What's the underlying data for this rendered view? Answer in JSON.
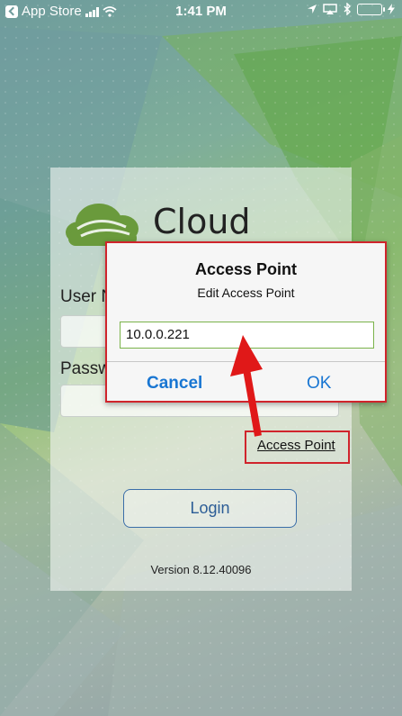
{
  "status_bar": {
    "back_app": "App Store",
    "time": "1:41 PM",
    "battery_color": "#4cd964"
  },
  "login": {
    "app_name": "Cloud Drive",
    "username_label": "User N",
    "password_label": "Passw",
    "access_point_link": "Access Point",
    "login_button": "Login",
    "version": "Version 8.12.40096",
    "logo_color": "#6a9a3c"
  },
  "dialog": {
    "title": "Access Point",
    "message": "Edit Access Point",
    "input_value": "10.0.0.221",
    "cancel_label": "Cancel",
    "ok_label": "OK",
    "accent_color": "#1976d2"
  },
  "annotation": {
    "highlight_color": "#d0242c"
  }
}
